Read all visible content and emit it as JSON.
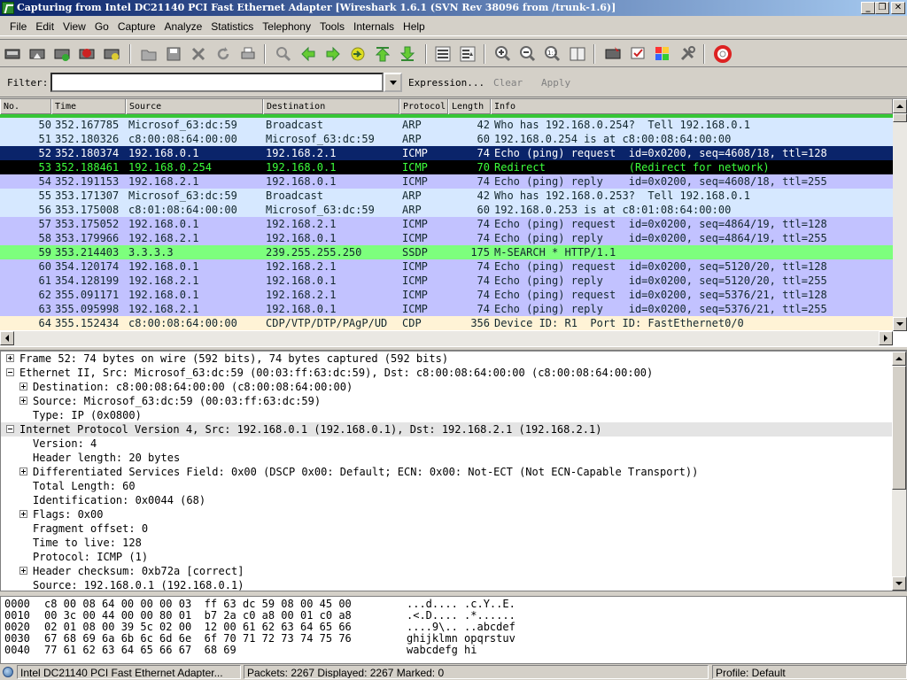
{
  "window": {
    "title": "Capturing from Intel DC21140 PCI Fast Ethernet Adapter    [Wireshark 1.6.1  (SVN Rev 38096 from /trunk-1.6)]",
    "min_label": "_",
    "max_label": "❐",
    "close_label": "✕"
  },
  "menu": [
    "File",
    "Edit",
    "View",
    "Go",
    "Capture",
    "Analyze",
    "Statistics",
    "Telephony",
    "Tools",
    "Internals",
    "Help"
  ],
  "filter": {
    "label": "Filter:",
    "value": "",
    "expression_label": "Expression...",
    "clear_label": "Clear",
    "apply_label": "Apply"
  },
  "columns": [
    "No.",
    "Time",
    "Source",
    "Destination",
    "Protocol",
    "Length",
    "Info"
  ],
  "packets": [
    {
      "no": "50",
      "time": "352.167785",
      "src": "Microsof_63:dc:59",
      "dst": "Broadcast",
      "proto": "ARP",
      "len": "42",
      "info": "Who has 192.168.0.254?  Tell 192.168.0.1",
      "bg": "#d6e8ff",
      "fg": "#12272e"
    },
    {
      "no": "51",
      "time": "352.180326",
      "src": "c8:00:08:64:00:00",
      "dst": "Microsof_63:dc:59",
      "proto": "ARP",
      "len": "60",
      "info": "192.168.0.254 is at c8:00:08:64:00:00",
      "bg": "#d6e8ff",
      "fg": "#12272e"
    },
    {
      "no": "52",
      "time": "352.180374",
      "src": "192.168.0.1",
      "dst": "192.168.2.1",
      "proto": "ICMP",
      "len": "74",
      "info": "Echo (ping) request  id=0x0200, seq=4608/18, ttl=128",
      "bg": "#0a246a",
      "fg": "#ffffff"
    },
    {
      "no": "53",
      "time": "352.188461",
      "src": "192.168.0.254",
      "dst": "192.168.0.1",
      "proto": "ICMP",
      "len": "70",
      "info": "Redirect             (Redirect for network)",
      "bg": "#000000",
      "fg": "#3cff3c"
    },
    {
      "no": "54",
      "time": "352.191153",
      "src": "192.168.2.1",
      "dst": "192.168.0.1",
      "proto": "ICMP",
      "len": "74",
      "info": "Echo (ping) reply    id=0x0200, seq=4608/18, ttl=255",
      "bg": "#c2c2ff",
      "fg": "#12272e"
    },
    {
      "no": "55",
      "time": "353.171307",
      "src": "Microsof_63:dc:59",
      "dst": "Broadcast",
      "proto": "ARP",
      "len": "42",
      "info": "Who has 192.168.0.253?  Tell 192.168.0.1",
      "bg": "#d6e8ff",
      "fg": "#12272e"
    },
    {
      "no": "56",
      "time": "353.175008",
      "src": "c8:01:08:64:00:00",
      "dst": "Microsof_63:dc:59",
      "proto": "ARP",
      "len": "60",
      "info": "192.168.0.253 is at c8:01:08:64:00:00",
      "bg": "#d6e8ff",
      "fg": "#12272e"
    },
    {
      "no": "57",
      "time": "353.175052",
      "src": "192.168.0.1",
      "dst": "192.168.2.1",
      "proto": "ICMP",
      "len": "74",
      "info": "Echo (ping) request  id=0x0200, seq=4864/19, ttl=128",
      "bg": "#c2c2ff",
      "fg": "#12272e"
    },
    {
      "no": "58",
      "time": "353.179966",
      "src": "192.168.2.1",
      "dst": "192.168.0.1",
      "proto": "ICMP",
      "len": "74",
      "info": "Echo (ping) reply    id=0x0200, seq=4864/19, ttl=255",
      "bg": "#c2c2ff",
      "fg": "#12272e"
    },
    {
      "no": "59",
      "time": "353.214403",
      "src": "3.3.3.3",
      "dst": "239.255.255.250",
      "proto": "SSDP",
      "len": "175",
      "info": "M-SEARCH * HTTP/1.1",
      "bg": "#7dff7d",
      "fg": "#12272e"
    },
    {
      "no": "60",
      "time": "354.120174",
      "src": "192.168.0.1",
      "dst": "192.168.2.1",
      "proto": "ICMP",
      "len": "74",
      "info": "Echo (ping) request  id=0x0200, seq=5120/20, ttl=128",
      "bg": "#c2c2ff",
      "fg": "#12272e"
    },
    {
      "no": "61",
      "time": "354.128199",
      "src": "192.168.2.1",
      "dst": "192.168.0.1",
      "proto": "ICMP",
      "len": "74",
      "info": "Echo (ping) reply    id=0x0200, seq=5120/20, ttl=255",
      "bg": "#c2c2ff",
      "fg": "#12272e"
    },
    {
      "no": "62",
      "time": "355.091171",
      "src": "192.168.0.1",
      "dst": "192.168.2.1",
      "proto": "ICMP",
      "len": "74",
      "info": "Echo (ping) request  id=0x0200, seq=5376/21, ttl=128",
      "bg": "#c2c2ff",
      "fg": "#12272e"
    },
    {
      "no": "63",
      "time": "355.095998",
      "src": "192.168.2.1",
      "dst": "192.168.0.1",
      "proto": "ICMP",
      "len": "74",
      "info": "Echo (ping) reply    id=0x0200, seq=5376/21, ttl=255",
      "bg": "#c2c2ff",
      "fg": "#12272e"
    },
    {
      "no": "64",
      "time": "355.152434",
      "src": "c8:00:08:64:00:00",
      "dst": "CDP/VTP/DTP/PAgP/UD",
      "proto": "CDP",
      "len": "356",
      "info": "Device ID: R1  Port ID: FastEthernet0/0",
      "bg": "#fff3d6",
      "fg": "#12272e"
    }
  ],
  "details": [
    {
      "level": 0,
      "exp": "plus",
      "text": "Frame 52: 74 bytes on wire (592 bits), 74 bytes captured (592 bits)",
      "sel": false
    },
    {
      "level": 0,
      "exp": "minus",
      "text": "Ethernet II, Src: Microsof_63:dc:59 (00:03:ff:63:dc:59), Dst: c8:00:08:64:00:00 (c8:00:08:64:00:00)",
      "sel": false
    },
    {
      "level": 1,
      "exp": "plus",
      "text": "Destination: c8:00:08:64:00:00 (c8:00:08:64:00:00)",
      "sel": false
    },
    {
      "level": 1,
      "exp": "plus",
      "text": "Source: Microsof_63:dc:59 (00:03:ff:63:dc:59)",
      "sel": false
    },
    {
      "level": 1,
      "exp": "",
      "text": "Type: IP (0x0800)",
      "sel": false
    },
    {
      "level": 0,
      "exp": "minus",
      "text": "Internet Protocol Version 4, Src: 192.168.0.1 (192.168.0.1), Dst: 192.168.2.1 (192.168.2.1)",
      "sel": true
    },
    {
      "level": 1,
      "exp": "",
      "text": "Version: 4",
      "sel": false
    },
    {
      "level": 1,
      "exp": "",
      "text": "Header length: 20 bytes",
      "sel": false
    },
    {
      "level": 1,
      "exp": "plus",
      "text": "Differentiated Services Field: 0x00 (DSCP 0x00: Default; ECN: 0x00: Not-ECT (Not ECN-Capable Transport))",
      "sel": false
    },
    {
      "level": 1,
      "exp": "",
      "text": "Total Length: 60",
      "sel": false
    },
    {
      "level": 1,
      "exp": "",
      "text": "Identification: 0x0044 (68)",
      "sel": false
    },
    {
      "level": 1,
      "exp": "plus",
      "text": "Flags: 0x00",
      "sel": false
    },
    {
      "level": 1,
      "exp": "",
      "text": "Fragment offset: 0",
      "sel": false
    },
    {
      "level": 1,
      "exp": "",
      "text": "Time to live: 128",
      "sel": false
    },
    {
      "level": 1,
      "exp": "",
      "text": "Protocol: ICMP (1)",
      "sel": false
    },
    {
      "level": 1,
      "exp": "plus",
      "text": "Header checksum: 0xb72a [correct]",
      "sel": false
    },
    {
      "level": 1,
      "exp": "",
      "text": "Source: 192.168.0.1 (192.168.0.1)",
      "sel": false
    }
  ],
  "hexdump": [
    {
      "off": "0000",
      "hex": "c8 00 08 64 00 00 00 03  ff 63 dc 59 08 00 45 00",
      "ascii": "...d.... .c.Y..E."
    },
    {
      "off": "0010",
      "hex": "00 3c 00 44 00 00 80 01  b7 2a c0 a8 00 01 c0 a8",
      "ascii": ".<.D.... .*......"
    },
    {
      "off": "0020",
      "hex": "02 01 08 00 39 5c 02 00  12 00 61 62 63 64 65 66",
      "ascii": "....9\\.. ..abcdef"
    },
    {
      "off": "0030",
      "hex": "67 68 69 6a 6b 6c 6d 6e  6f 70 71 72 73 74 75 76",
      "ascii": "ghijklmn opqrstuv"
    },
    {
      "off": "0040",
      "hex": "77 61 62 63 64 65 66 67  68 69",
      "ascii": "wabcdefg hi"
    }
  ],
  "status": {
    "adapter": "Intel DC21140 PCI Fast Ethernet Adapter...",
    "packets": "Packets: 2267 Displayed: 2267 Marked: 0",
    "profile": "Profile: Default"
  },
  "toolbar_icons": [
    "interface-list-icon",
    "capture-options-icon",
    "start-capture-icon",
    "stop-capture-icon",
    "restart-capture-icon",
    "open-file-icon",
    "save-file-icon",
    "close-file-icon",
    "reload-icon",
    "print-icon",
    "find-icon",
    "go-back-icon",
    "go-forward-icon",
    "go-to-packet-icon",
    "go-first-icon",
    "go-last-icon",
    "colorize-icon",
    "auto-scroll-icon",
    "zoom-in-icon",
    "zoom-out-icon",
    "zoom-normal-icon",
    "resize-columns-icon",
    "capture-filters-icon",
    "display-filters-icon",
    "coloring-rules-icon",
    "preferences-icon",
    "help-icon"
  ]
}
